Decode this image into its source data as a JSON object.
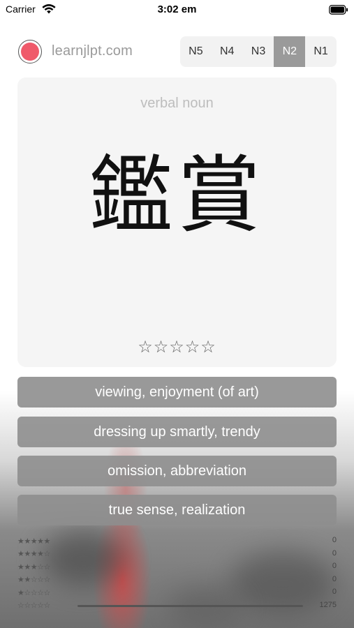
{
  "status_bar": {
    "carrier": "Carrier",
    "time": "3:02 em"
  },
  "header": {
    "site": "learnjlpt.com",
    "levels": [
      "N5",
      "N4",
      "N3",
      "N2",
      "N1"
    ],
    "active_level": "N2"
  },
  "card": {
    "type": "verbal noun",
    "kanji": "鑑賞",
    "rating_stars": "☆☆☆☆☆",
    "rating": 0
  },
  "answers": [
    "viewing, enjoyment (of art)",
    "dressing up smartly, trendy",
    "omission, abbreviation",
    "true sense, realization"
  ],
  "stats": [
    {
      "stars": "★★★★★",
      "count": "0",
      "fraction": 0
    },
    {
      "stars": "★★★★☆",
      "count": "0",
      "fraction": 0
    },
    {
      "stars": "★★★☆☆",
      "count": "0",
      "fraction": 0
    },
    {
      "stars": "★★☆☆☆",
      "count": "0",
      "fraction": 0
    },
    {
      "stars": "★☆☆☆☆",
      "count": "0",
      "fraction": 0
    },
    {
      "stars": "☆☆☆☆☆",
      "count": "1275",
      "fraction": 1
    }
  ],
  "colors": {
    "accent_record": "#ef5a6a",
    "active_tab": "#9a9a9a",
    "answer_bg": "#8e8e8e"
  }
}
